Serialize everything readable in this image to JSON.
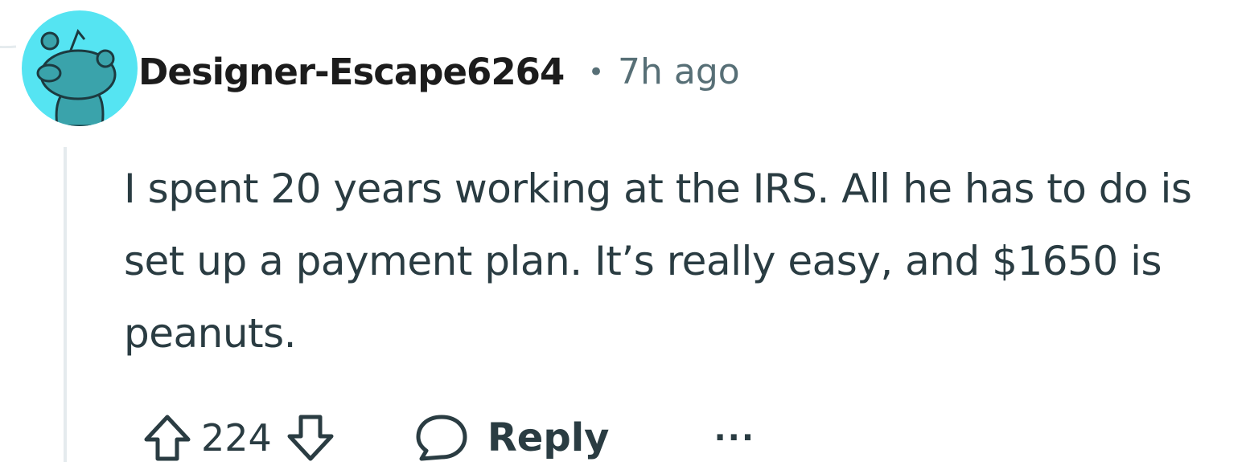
{
  "comment": {
    "author": "Designer-Escape6264",
    "separator": "•",
    "timestamp": "7h ago",
    "body": "I spent 20 years working at the IRS. All he has to do is set up a payment plan. It’s really easy, and $1650 is peanuts.",
    "score": "224",
    "reply_label": "Reply",
    "more_label": "···"
  },
  "icons": {
    "avatar": "snoo-avatar-icon",
    "upvote": "arrow-up-icon",
    "downvote": "arrow-down-icon",
    "reply": "speech-bubble-icon",
    "more": "ellipsis-icon"
  },
  "colors": {
    "avatar_bg": "#55e4f2",
    "snoo_body": "#3aa3ab",
    "meta_text": "#576f76",
    "body_text": "#2a3c42",
    "thread_line": "#e5ebee"
  }
}
